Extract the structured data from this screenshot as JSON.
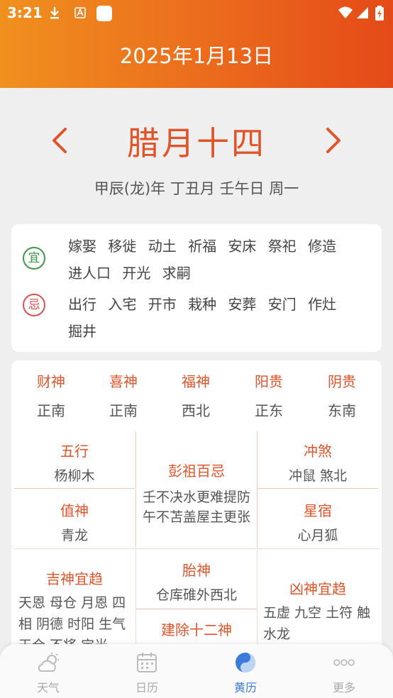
{
  "status_bar": {
    "time": "3:21"
  },
  "header": {
    "title": "2025年1月13日"
  },
  "lunar": {
    "title": "腊月十四",
    "ganzhi": "甲辰(龙)年  丁丑月  壬午日  周一"
  },
  "yiji": {
    "yi_icon": "宜",
    "yi_line1": "嫁娶  移徙  动土  祈福  安床  祭祀  修造",
    "yi_line2": "进人口  开光  求嗣",
    "ji_icon": "忌",
    "ji_line1": "出行  入宅  开市  栽种  安葬  安门  作灶",
    "ji_line2": "掘井",
    "yi_color": "#3d9a4a",
    "ji_color": "#d9534f"
  },
  "gods": [
    {
      "title": "财神",
      "value": "正南"
    },
    {
      "title": "喜神",
      "value": "正南"
    },
    {
      "title": "福神",
      "value": "西北"
    },
    {
      "title": "阳贵",
      "value": "正东"
    },
    {
      "title": "阴贵",
      "value": "东南"
    }
  ],
  "grid": {
    "wuxing": {
      "title": "五行",
      "value": "杨柳木"
    },
    "zhishen": {
      "title": "值神",
      "value": "青龙"
    },
    "pengzu": {
      "title": "彭祖百忌",
      "line1": "壬不决水更难提防",
      "line2": "午不苫盖屋主更张"
    },
    "chongsha": {
      "title": "冲煞",
      "value": "冲鼠  煞北"
    },
    "xingxiu": {
      "title": "星宿",
      "value": "心月狐"
    },
    "jishen": {
      "title": "吉神宜趋",
      "line1": "天恩 母仓 月恩 四",
      "line2": "相 阴德 时阳 生气",
      "line3": "天仓 不将 宝光"
    },
    "taishen": {
      "title": "胎神",
      "value": "仓库碓外西北"
    },
    "jianchu": {
      "title": "建除十二神"
    },
    "xiongshen": {
      "title": "凶神宜趋",
      "line1": "五虚 九空 土符 触",
      "line2": "水龙"
    }
  },
  "bottom_nav": [
    {
      "label": "天气",
      "icon": "weather-icon"
    },
    {
      "label": "日历",
      "icon": "calendar-icon"
    },
    {
      "label": "黄历",
      "icon": "yinyang-icon"
    },
    {
      "label": "更多",
      "icon": "more-icon"
    }
  ],
  "accent_color": "#e0542a",
  "active_tab_color": "#3a7bdc"
}
